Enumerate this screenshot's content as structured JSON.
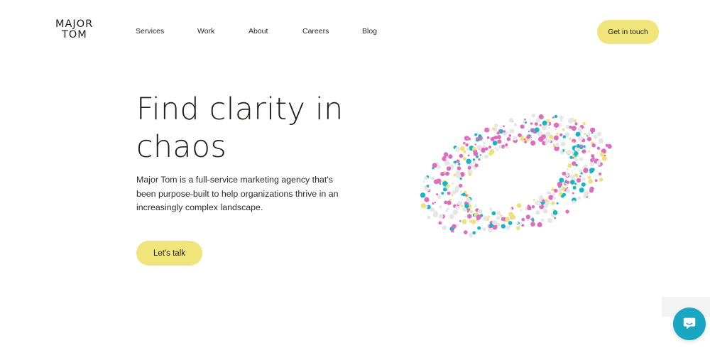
{
  "logo": {
    "line1": "MAJOR",
    "line2": "TOM"
  },
  "nav": {
    "items": [
      {
        "label": "Services"
      },
      {
        "label": "Work"
      },
      {
        "label": "About"
      },
      {
        "label": "Careers"
      },
      {
        "label": "Blog"
      }
    ]
  },
  "header": {
    "cta_label": "Get in touch"
  },
  "hero": {
    "headline": "Find clarity in chaos",
    "intro": "Major Tom is a full-service marketing agency that's been purpose-built to help organizations thrive in an increasingly complex landscape.",
    "cta_label": "Let's talk"
  },
  "colors": {
    "accent_yellow": "#f0e57a",
    "chat_teal": "#19a6c3",
    "dot_cyan": "#16b5c7",
    "dot_pink": "#de6dbd",
    "dot_yellow": "#efe17a",
    "dot_gray": "#e6e6e6"
  },
  "icons": {
    "chat": "chat-bubble-icon"
  }
}
